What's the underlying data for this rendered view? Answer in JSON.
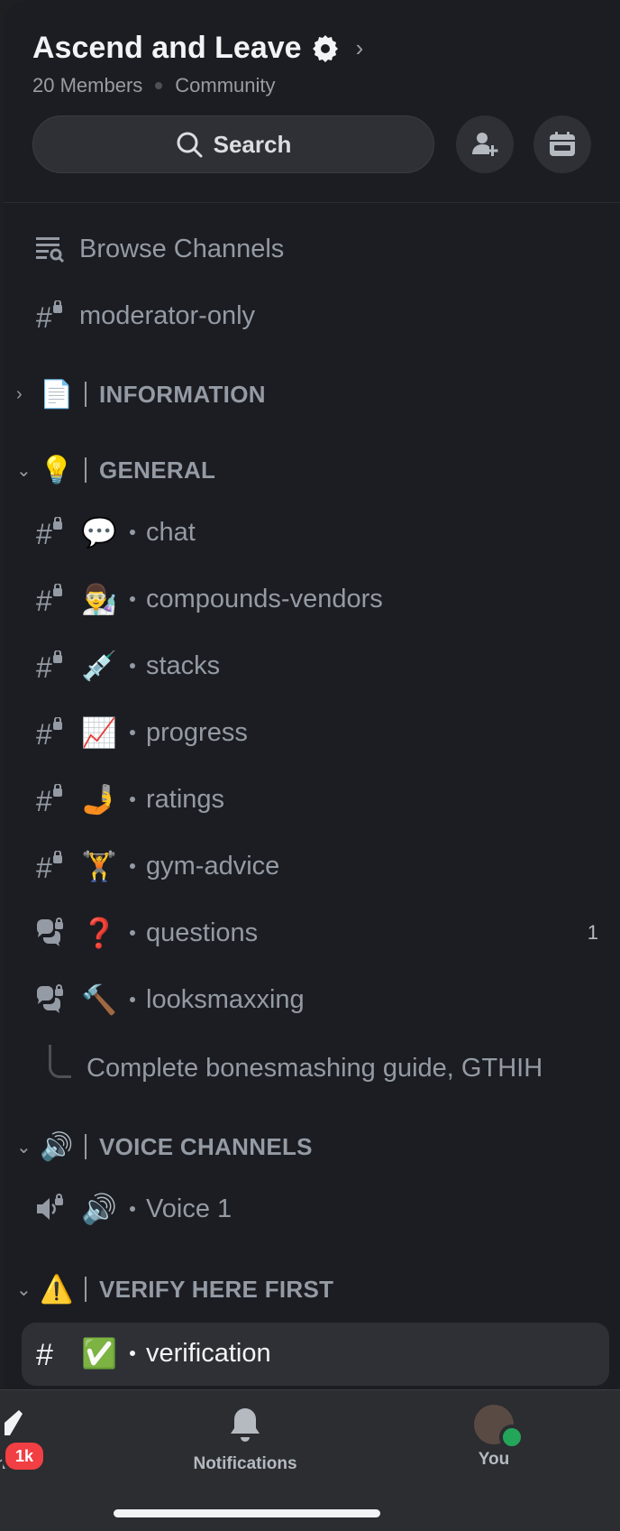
{
  "server": {
    "name": "Ascend and Leave",
    "members": "20 Members",
    "type": "Community"
  },
  "search": {
    "label": "Search"
  },
  "browse": {
    "label": "Browse Channels"
  },
  "mod_channel": {
    "label": "moderator-only"
  },
  "categories": {
    "information": {
      "emoji": "📄",
      "title": "INFORMATION"
    },
    "general": {
      "emoji": "💡",
      "title": "GENERAL"
    },
    "voice": {
      "emoji": "🔊",
      "title": "VOICE CHANNELS"
    },
    "verify": {
      "emoji": "⚠️",
      "title": "VERIFY HERE FIRST"
    }
  },
  "channels": [
    {
      "emoji": "💬",
      "name": "chat"
    },
    {
      "emoji": "👨‍🔬",
      "name": "compounds-vendors"
    },
    {
      "emoji": "💉",
      "name": "stacks"
    },
    {
      "emoji": "📈",
      "name": "progress"
    },
    {
      "emoji": "🤳",
      "name": "ratings"
    },
    {
      "emoji": "🏋️",
      "name": "gym-advice"
    },
    {
      "emoji": "❓",
      "name": "questions",
      "count": "1"
    },
    {
      "emoji": "🔨",
      "name": "looksmaxxing"
    }
  ],
  "thread": {
    "label": "Complete bonesmashing guide, GTHIH"
  },
  "voice_channel": {
    "emoji": "🔊",
    "name": "Voice 1"
  },
  "verify_channel": {
    "emoji": "✅",
    "name": "verification"
  },
  "nav": {
    "home": {
      "label": "me",
      "badge": "1k"
    },
    "notifications": {
      "label": "Notifications"
    },
    "you": {
      "label": "You"
    }
  },
  "colors": {
    "accent_red": "#f23f43",
    "online_green": "#23a55a",
    "background": "#1c1d22"
  }
}
